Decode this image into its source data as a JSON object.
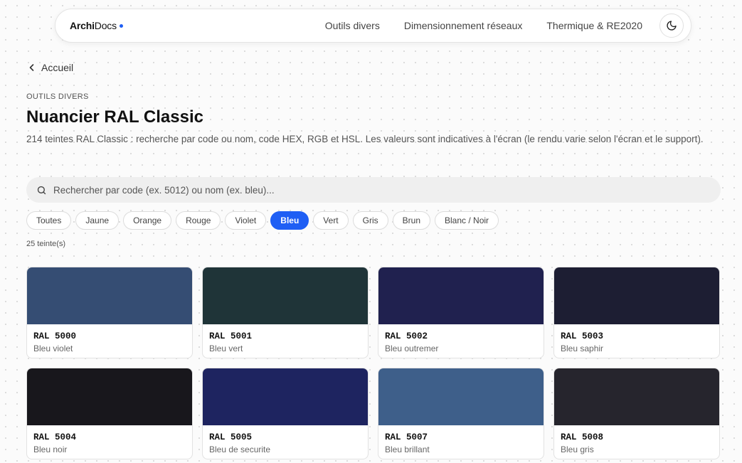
{
  "header": {
    "brand_bold": "Archi",
    "brand_rest": "Docs",
    "nav": [
      "Outils divers",
      "Dimensionnement réseaux",
      "Thermique & RE2020"
    ],
    "theme_icon": "moon-icon",
    "accent_color": "#1f5ff4"
  },
  "breadcrumb": {
    "back_label": "Accueil",
    "icon": "chevron-left-icon"
  },
  "page": {
    "eyebrow": "OUTILS DIVERS",
    "title": "Nuancier RAL Classic",
    "description": "214 teintes RAL Classic : recherche par code ou nom, code HEX, RGB et HSL. Les valeurs sont indicatives à l'écran (le rendu varie selon l'écran et le support)."
  },
  "search": {
    "icon": "search-icon",
    "placeholder": "Rechercher par code (ex. 5012) ou nom (ex. bleu)...",
    "value": ""
  },
  "filters": {
    "items": [
      "Toutes",
      "Jaune",
      "Orange",
      "Rouge",
      "Violet",
      "Bleu",
      "Vert",
      "Gris",
      "Brun",
      "Blanc / Noir"
    ],
    "active": "Bleu"
  },
  "results_count": "25 teinte(s)",
  "colors": [
    {
      "code": "RAL 5000",
      "name": "Bleu violet",
      "hex": "#354D73"
    },
    {
      "code": "RAL 5001",
      "name": "Bleu vert",
      "hex": "#1F3438"
    },
    {
      "code": "RAL 5002",
      "name": "Bleu outremer",
      "hex": "#20214F"
    },
    {
      "code": "RAL 5003",
      "name": "Bleu saphir",
      "hex": "#1D1E33"
    },
    {
      "code": "RAL 5004",
      "name": "Bleu noir",
      "hex": "#18171C"
    },
    {
      "code": "RAL 5005",
      "name": "Bleu de securite",
      "hex": "#1E2460"
    },
    {
      "code": "RAL 5007",
      "name": "Bleu brillant",
      "hex": "#3E5F8A"
    },
    {
      "code": "RAL 5008",
      "name": "Bleu gris",
      "hex": "#26252D"
    }
  ]
}
